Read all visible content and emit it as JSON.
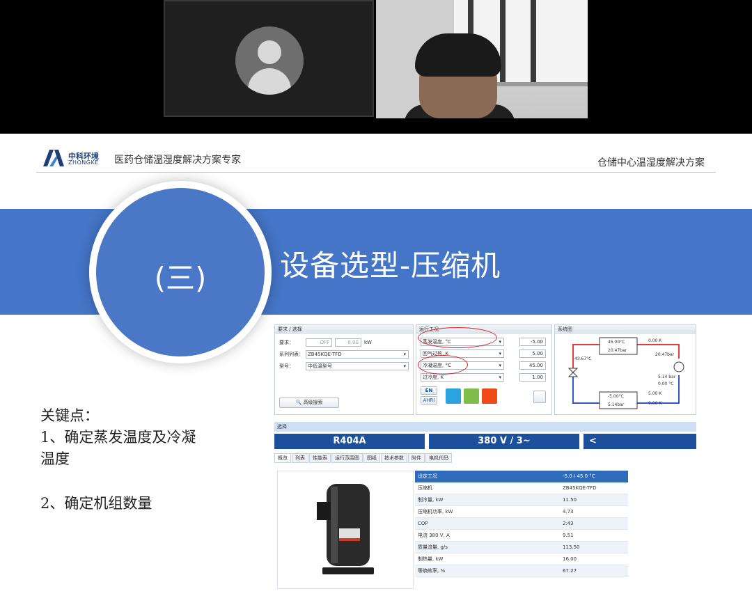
{
  "slide": {
    "logo_cn": "中科环境",
    "logo_en": "ZHONGKE",
    "header_left": "医药仓储温湿度解决方案专家",
    "header_right": "仓储中心温湿度解决方案",
    "section_number": "(三)",
    "section_title": "设备选型-压缩机",
    "key_points_title": "关键点：",
    "key_point_1a": "1、确定蒸发温度及冷凝",
    "key_point_1b": "温度",
    "key_point_2": "2、确定机组数量"
  },
  "software": {
    "req_pane_title": "要求 / 选择",
    "req_label": "要求：",
    "req_off": "OFF",
    "req_value": "0.00",
    "req_unit": "kW",
    "series_label": "系列列表：",
    "series_value": "ZB45KQE-TFD",
    "model_label": "型号：",
    "model_value": "中低温型号",
    "advanced_search": "高级搜索",
    "ops_pane_title": "运行工况",
    "evap_label": "蒸发温度, °C",
    "evap_value": "-5.00",
    "return_label": "回气过热, K",
    "return_value": "5.00",
    "cond_label": "冷凝温度, °C",
    "cond_value": "45.00",
    "subcool_label": "过冷度, K",
    "subcool_value": "1.00",
    "btn_en": "EN",
    "btn_ahri": "AHRI",
    "sys_pane_title": "系统图",
    "sys_t_cond": "45.00°C",
    "sys_p_cond": "20.47bar",
    "sys_dk_top": "0.00 K",
    "sys_t_liquid": "43.67°C",
    "sys_p_right": "20.47bar",
    "sys_p_mid": "5.14 bar",
    "sys_dk_mid": "0.00 °C",
    "sys_t_evap": "-5.00°C",
    "sys_p_evap": "5.14bar",
    "sys_sh": "5.00 K",
    "sys_dk_bottom": "0.00 K",
    "select_label": "选择",
    "refrigerant": "R404A",
    "voltage": "380 V / 3~",
    "tabs": [
      "概览",
      "列表",
      "性能表",
      "运行范围图",
      "图纸",
      "技术参数",
      "附件",
      "电机代码"
    ],
    "table_header": [
      "设定工况",
      "-5.0 / 45.0 °C"
    ],
    "table_rows": [
      [
        "压缩机",
        "ZB45KQE-TFD"
      ],
      [
        "制冷量, kW",
        "11.50"
      ],
      [
        "压缩机功率, kW",
        "4.73"
      ],
      [
        "COP",
        "2.43"
      ],
      [
        "电流 380 V, A",
        "9.51"
      ],
      [
        "质量流量, g/s",
        "113.50"
      ],
      [
        "制热量, kW",
        "16.00"
      ],
      [
        "等熵效率, %",
        "67.27"
      ]
    ]
  },
  "colors": {
    "banner": "#4475c7",
    "circle": "#4a77c6",
    "button_blue": "#1c4f9c",
    "table_header": "#2f6bb8",
    "annotation_red": "#e02020"
  }
}
